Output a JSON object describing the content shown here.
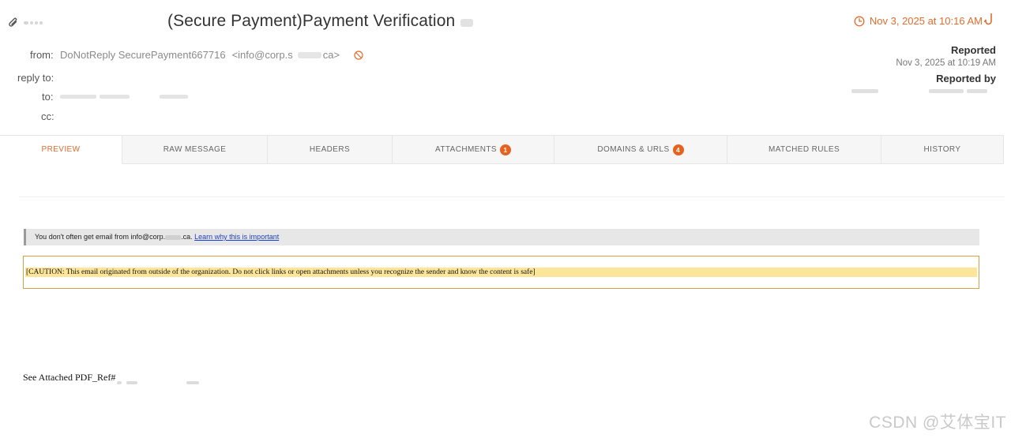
{
  "email": {
    "subject": "(Secure Payment)Payment Verification",
    "received": "Nov 3, 2025 at 10:16 AM",
    "from_label": "from:",
    "from_name": "DoNotReply SecurePayment667716",
    "from_address_start": "<info@corp.s",
    "from_address_end": "ca>",
    "reply_to_label": "reply to:",
    "to_label": "to:",
    "cc_label": "cc:"
  },
  "report": {
    "reported_label": "Reported",
    "reported_date": "Nov 3, 2025 at 10:19 AM",
    "reported_by_label": "Reported by"
  },
  "tabs": [
    {
      "label": "PREVIEW",
      "active": true
    },
    {
      "label": "RAW MESSAGE"
    },
    {
      "label": "HEADERS"
    },
    {
      "label": "ATTACHMENTS",
      "badge": "1"
    },
    {
      "label": "DOMAINS & URLS",
      "badge": "4"
    },
    {
      "label": "MATCHED RULES"
    },
    {
      "label": "HISTORY"
    }
  ],
  "preview": {
    "notice_text_start": "You don't often get email from info@corp.",
    "notice_text_end": ".ca.",
    "notice_link": "Learn why this is important",
    "caution": "[CAUTION: This email originated from outside of the organization. Do not click links or open attachments unless you recognize the sender and know the content is safe]",
    "body_text": "See Attached PDF_Ref#"
  },
  "watermark": "CSDN @艾体宝IT",
  "colors": {
    "accent": "#e46b2c",
    "badge": "#e8621f",
    "link": "#1a3ec9",
    "caution_bg": "#fde69a",
    "caution_border": "#d8a040"
  },
  "icons": {
    "attachment": "paperclip-icon",
    "clock": "clock-icon",
    "hook": "fishing-hook-icon",
    "block": "ban-icon"
  }
}
